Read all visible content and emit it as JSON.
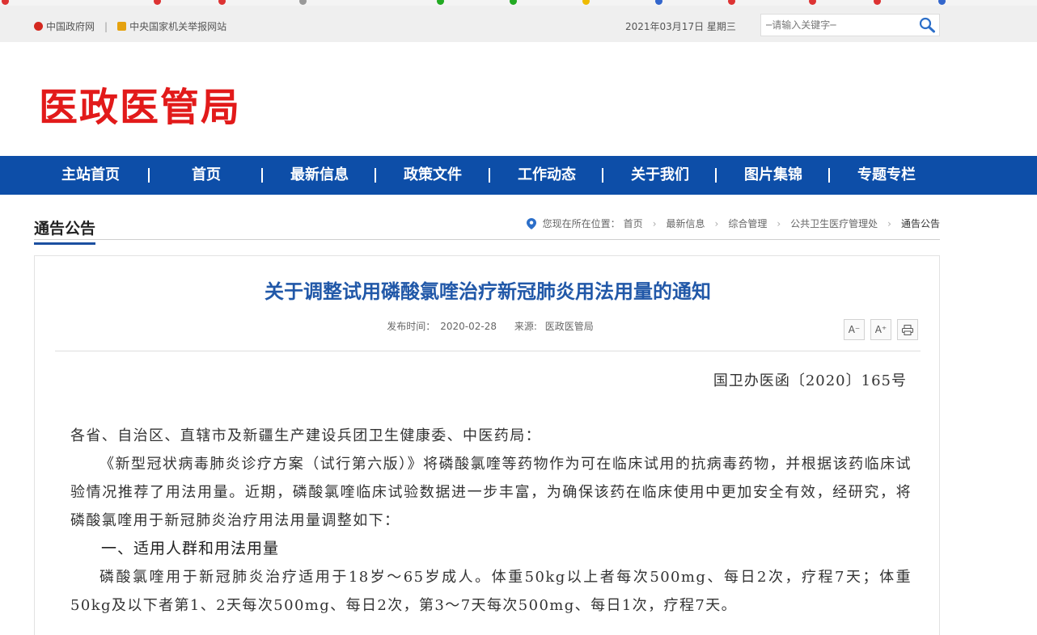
{
  "topbar": {
    "link_gov": "中国政府网",
    "link_report": "中央国家机关举报网站",
    "date": "2021年03月17日 星期三",
    "search_placeholder": "─请输入关键字─"
  },
  "logo": "医政医管局",
  "nav": [
    "主站首页",
    "首页",
    "最新信息",
    "政策文件",
    "工作动态",
    "关于我们",
    "图片集锦",
    "专题专栏"
  ],
  "section": {
    "title": "通告公告",
    "breadcrumb": [
      "您现在所在位置：",
      "首页",
      "最新信息",
      "综合管理",
      "公共卫生医疗管理处",
      "通告公告"
    ]
  },
  "article": {
    "title": "关于调整试用磷酸氯喹治疗新冠肺炎用法用量的通知",
    "date_label": "发布时间：",
    "date": "2020-02-28",
    "source_label": "来源:",
    "source": "医政医管局",
    "tool_decrease": "A⁻",
    "tool_increase": "A⁺",
    "doc_number": "国卫办医函〔2020〕165号",
    "recipients": "各省、自治区、直辖市及新疆生产建设兵团卫生健康委、中医药局：",
    "para1": "《新型冠状病毒肺炎诊疗方案（试行第六版）》将磷酸氯喹等药物作为可在临床试用的抗病毒药物，并根据该药临床试验情况推荐了用法用量。近期，磷酸氯喹临床试验数据进一步丰富，为确保该药在临床使用中更加安全有效，经研究，将磷酸氯喹用于新冠肺炎治疗用法用量调整如下：",
    "heading1": "一、适用人群和用法用量",
    "para2": "磷酸氯喹用于新冠肺炎治疗适用于18岁～65岁成人。体重50kg以上者每次500mg、每日2次，疗程7天；体重50kg及以下者第1、2天每次500mg、每日2次，第3～7天每次500mg、每日1次，疗程7天。"
  },
  "colors": {
    "nav_bg": "#0d4ea8",
    "logo_red": "#e21a1a",
    "title_blue": "#2158a8"
  }
}
